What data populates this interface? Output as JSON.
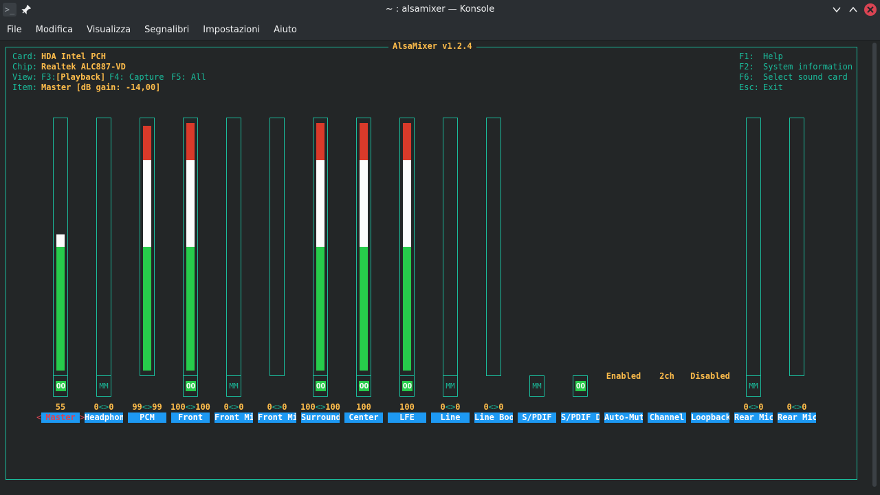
{
  "window": {
    "title": "~ : alsamixer — Konsole",
    "app_icon": "terminal-icon",
    "pin_icon": "pin-icon",
    "minimize_glyph": "∨",
    "maximize_glyph": "∧",
    "close_glyph": "✕"
  },
  "menu": [
    "File",
    "Modifica",
    "Visualizza",
    "Segnalibri",
    "Impostazioni",
    "Aiuto"
  ],
  "mixer": {
    "title": "AlsaMixer v1.2.4",
    "card_label": "Card:",
    "card_value": "HDA Intel PCH",
    "chip_label": "Chip:",
    "chip_value": "Realtek ALC887-VD",
    "view_label": "View:",
    "view_f3": "F3:",
    "view_playback": "[Playback]",
    "view_f4": "F4: Capture",
    "view_f5": "F5: All",
    "item_label": "Item:",
    "item_value": "Master [dB gain: -14,00]",
    "help": [
      {
        "key": "F1:",
        "text": "Help"
      },
      {
        "key": "F2:",
        "text": "System information"
      },
      {
        "key": "F6:",
        "text": "Select sound card"
      },
      {
        "key": "Esc:",
        "text": "Exit"
      }
    ],
    "selected_left_mark": "<",
    "selected_right_mark": ">"
  },
  "controls": [
    {
      "label": "Master",
      "level": 55,
      "value_left": "55",
      "value_right": "",
      "switch": "OO",
      "selected": true
    },
    {
      "label": "Headphon",
      "level": 0,
      "value_left": "0",
      "value_right": "0",
      "switch": "MM"
    },
    {
      "label": "PCM",
      "level": 99,
      "value_left": "99",
      "value_right": "99",
      "switch": ""
    },
    {
      "label": "Front",
      "level": 100,
      "value_left": "100",
      "value_right": "100",
      "switch": "OO"
    },
    {
      "label": "Front Mi",
      "level": 0,
      "value_left": "0",
      "value_right": "0",
      "switch": "MM"
    },
    {
      "label": "Front Mi",
      "level": 0,
      "value_left": "0",
      "value_right": "0",
      "switch": ""
    },
    {
      "label": "Surround",
      "level": 100,
      "value_left": "100",
      "value_right": "100",
      "switch": "OO"
    },
    {
      "label": "Center",
      "level": 100,
      "value_left": "100",
      "value_right": "",
      "switch": "OO"
    },
    {
      "label": "LFE",
      "level": 100,
      "value_left": "100",
      "value_right": "",
      "switch": "OO"
    },
    {
      "label": "Line",
      "level": 0,
      "value_left": "0",
      "value_right": "0",
      "switch": "MM"
    },
    {
      "label": "Line Boo",
      "level": 0,
      "value_left": "0",
      "value_right": "0",
      "switch": ""
    },
    {
      "label": "S/PDIF",
      "level": null,
      "switch": "MM"
    },
    {
      "label": "S/PDIF D",
      "level": null,
      "switch": "OO"
    },
    {
      "label": "Auto-Mut",
      "level": null,
      "enum": "Enabled"
    },
    {
      "label": "Channel",
      "level": null,
      "enum": "2ch"
    },
    {
      "label": "Loopback",
      "level": null,
      "enum": "Disabled"
    },
    {
      "label": "Rear Mic",
      "level": 0,
      "value_left": "0",
      "value_right": "0",
      "switch": "MM"
    },
    {
      "label": "Rear Mic",
      "level": 0,
      "value_left": "0",
      "value_right": "0",
      "switch": ""
    }
  ],
  "colors": {
    "border": "#1abc9c",
    "label_bg": "#1d99f3",
    "value": "#fdbc4b",
    "green": "#27cc4b",
    "white": "#fcfcfc",
    "red": "#da3a2a"
  }
}
